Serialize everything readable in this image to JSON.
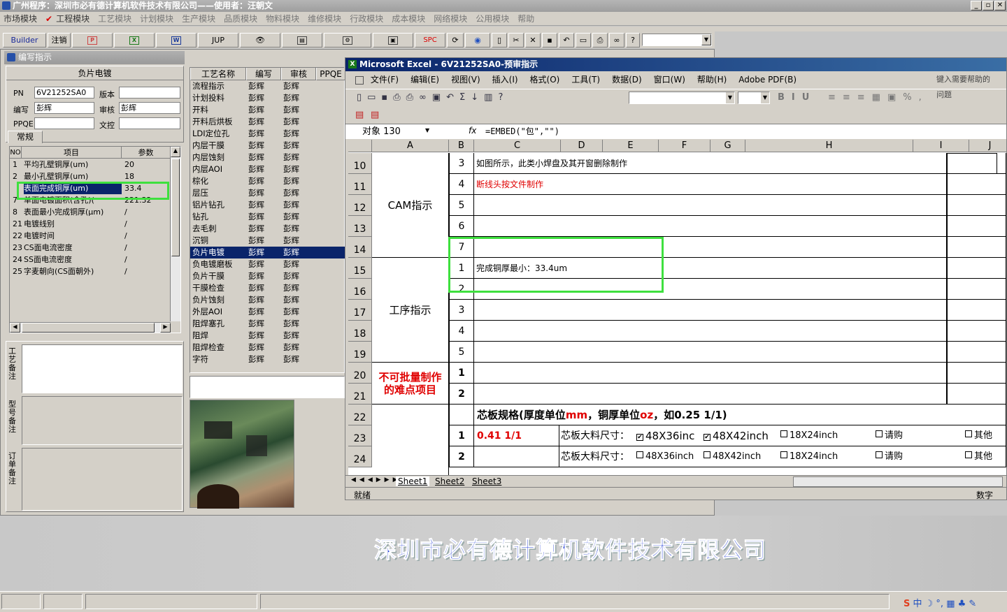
{
  "app": {
    "title": "广州程序：深圳市必有德计算机软件技术有限公司——使用者：汪朝文",
    "menu": [
      "市场模块",
      "工程模块",
      "工艺模块",
      "计划模块",
      "生产模块",
      "品质模块",
      "物料模块",
      "维修模块",
      "行政模块",
      "成本模块",
      "网络模块",
      "公用模块",
      "帮助"
    ],
    "company_banner": "深圳市必有德计算机软件技术有限公司"
  },
  "toolbar": {
    "builder": "Builder",
    "logout": "注销",
    "jup": "JUP",
    "spc": "SPC"
  },
  "left_panel": {
    "title": "编写指示",
    "section": "负片电镀",
    "pn_label": "PN",
    "pn_value": "6V21252SA0",
    "version_label": "版本",
    "version_value": "",
    "writer_label": "编写",
    "writer_value": "彭辉",
    "reviewer_label": "审核",
    "reviewer_value": "彭辉",
    "ppqe_label": "PPQE",
    "ppqe_value": "",
    "wencha_label": "文控",
    "wencha_value": "",
    "tab": "常规",
    "columns": [
      "NO",
      "项目",
      "参数"
    ],
    "rows": [
      {
        "no": "1",
        "item": "平均孔壁铜厚(um)",
        "param": "20"
      },
      {
        "no": "2",
        "item": "最小孔壁铜厚(um)",
        "param": "18"
      },
      {
        "no": "",
        "item": "表面完成铜厚(um)",
        "param": "33.4"
      },
      {
        "no": "7",
        "item": "单面电镀面积(含孔)(",
        "param": "221.32"
      },
      {
        "no": "8",
        "item": "表面最小完成铜厚(μm)",
        "param": "/"
      },
      {
        "no": "21",
        "item": "电镀线别",
        "param": "/"
      },
      {
        "no": "22",
        "item": "电镀时间",
        "param": "/"
      },
      {
        "no": "23",
        "item": "CS面电流密度",
        "param": "/"
      },
      {
        "no": "24",
        "item": "SS面电流密度",
        "param": "/"
      },
      {
        "no": "25",
        "item": "字麦朝向(CS面朝外)",
        "param": "/"
      }
    ],
    "note1": "工艺备注",
    "note2": "型号备注",
    "note3": "订单备注"
  },
  "process_list": {
    "columns": [
      "工艺名称",
      "编写",
      "审核",
      "PPQE"
    ],
    "rows": [
      [
        "流程指示",
        "彭辉",
        "彭辉"
      ],
      [
        "计划投料",
        "彭辉",
        "彭辉"
      ],
      [
        "开料",
        "彭辉",
        "彭辉"
      ],
      [
        "开料后烘板",
        "彭辉",
        "彭辉"
      ],
      [
        "LDI定位孔",
        "彭辉",
        "彭辉"
      ],
      [
        "内层干膜",
        "彭辉",
        "彭辉"
      ],
      [
        "内层蚀刻",
        "彭辉",
        "彭辉"
      ],
      [
        "内层AOI",
        "彭辉",
        "彭辉"
      ],
      [
        "棕化",
        "彭辉",
        "彭辉"
      ],
      [
        "层压",
        "彭辉",
        "彭辉"
      ],
      [
        "铝片钻孔",
        "彭辉",
        "彭辉"
      ],
      [
        "钻孔",
        "彭辉",
        "彭辉"
      ],
      [
        "去毛刺",
        "彭辉",
        "彭辉"
      ],
      [
        "沉铜",
        "彭辉",
        "彭辉"
      ],
      [
        "负片电镀",
        "彭辉",
        "彭辉"
      ],
      [
        "负电镀磨板",
        "彭辉",
        "彭辉"
      ],
      [
        "负片干膜",
        "彭辉",
        "彭辉"
      ],
      [
        "干膜检查",
        "彭辉",
        "彭辉"
      ],
      [
        "负片蚀刻",
        "彭辉",
        "彭辉"
      ],
      [
        "外层AOI",
        "彭辉",
        "彭辉"
      ],
      [
        "阻焊塞孔",
        "彭辉",
        "彭辉"
      ],
      [
        "阻焊",
        "彭辉",
        "彭辉"
      ],
      [
        "阻焊检查",
        "彭辉",
        "彭辉"
      ],
      [
        "字符",
        "彭辉",
        "彭辉"
      ]
    ],
    "selected_index": 14
  },
  "excel": {
    "title": "Microsoft Excel - 6V21252SA0-预审指示",
    "menu": [
      "文件(F)",
      "编辑(E)",
      "视图(V)",
      "插入(I)",
      "格式(O)",
      "工具(T)",
      "数据(D)",
      "窗口(W)",
      "帮助(H)",
      "Adobe PDF(B)"
    ],
    "help_box": "键入需要帮助的问题",
    "name_box": "对象 130",
    "fx": "fx",
    "formula": "=EMBED(\"包\",\"\")",
    "columns": [
      "A",
      "B",
      "C",
      "D",
      "E",
      "F",
      "G",
      "H",
      "I",
      "J"
    ],
    "rows": [
      {
        "num": "10",
        "b": "3",
        "c": "如图所示，此类小焊盘及其开窗删除制作",
        "red": false
      },
      {
        "num": "11",
        "b": "4",
        "c": "断线头按文件制作",
        "red": true
      },
      {
        "num": "12",
        "b": "5",
        "c": "",
        "red": false
      },
      {
        "num": "13",
        "b": "6",
        "c": "",
        "red": false
      },
      {
        "num": "14",
        "b": "7",
        "c": "",
        "red": false
      },
      {
        "num": "15",
        "b": "1",
        "c": "完成铜厚最小：33.4um",
        "red": false
      },
      {
        "num": "16",
        "b": "2",
        "c": "",
        "red": false
      },
      {
        "num": "17",
        "b": "3",
        "c": "",
        "red": false
      },
      {
        "num": "18",
        "b": "4",
        "c": "",
        "red": false
      },
      {
        "num": "19",
        "b": "5",
        "c": "",
        "red": false
      },
      {
        "num": "20",
        "b": "1",
        "c": "",
        "red": false
      },
      {
        "num": "21",
        "b": "2",
        "c": "",
        "red": false
      },
      {
        "num": "22",
        "b": "",
        "c": "",
        "red": false
      },
      {
        "num": "23",
        "b": "1",
        "c": "0.41 1/1",
        "red": true
      },
      {
        "num": "24",
        "b": "2",
        "c": "",
        "red": false
      }
    ],
    "cam_label": "CAM指示",
    "process_label": "工序指示",
    "difficult_label_1": "不可批量制作",
    "difficult_label_2": "的难点项目",
    "core_spec": "芯板规格(厚度单位mm，铜厚单位oz，如0.25 1/1)",
    "core_spec_parts": {
      "a": "芯板规格(厚度单位",
      "mm": "mm",
      "b": "，铜厚单位",
      "oz": "oz",
      "c": "，如0.25 1/1)"
    },
    "core_size_label": "芯板大料尺寸：",
    "row23_opts": [
      "48X36inc",
      "48X42inch",
      "18X24inch",
      "请购",
      "其他"
    ],
    "row24_opts": [
      "48X36inch",
      "48X42inch",
      "18X24inch",
      "请购",
      "其他"
    ],
    "sheets": [
      "Sheet1",
      "Sheet2",
      "Sheet3"
    ],
    "status": "就绪",
    "status_right": "数字"
  },
  "colors": {
    "highlight": "#3ee03e",
    "selection": "#0a246a",
    "red_text": "#e00000"
  }
}
